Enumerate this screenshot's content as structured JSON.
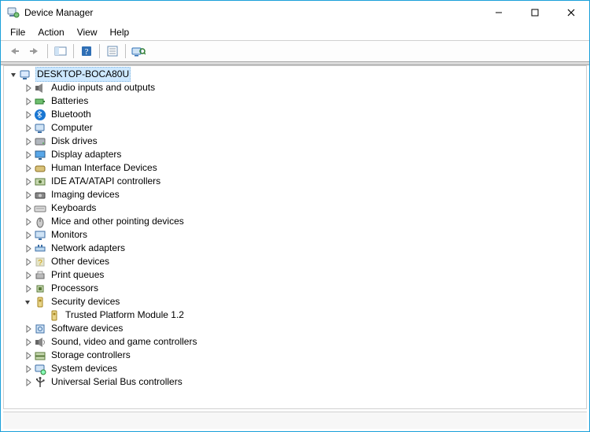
{
  "window": {
    "title": "Device Manager"
  },
  "menubar": {
    "items": [
      "File",
      "Action",
      "View",
      "Help"
    ]
  },
  "toolbar": {
    "back": "Back",
    "forward": "Forward",
    "show_hide_console_tree": "Show/Hide Console Tree",
    "help": "Help",
    "properties": "Properties",
    "scan": "Scan for hardware changes"
  },
  "tree": {
    "root": {
      "label": "DESKTOP-BOCA80U",
      "expanded": true,
      "selected": true,
      "icon": "computer-root-icon"
    },
    "categories": [
      {
        "label": "Audio inputs and outputs",
        "icon": "audio-icon",
        "expanded": false
      },
      {
        "label": "Batteries",
        "icon": "battery-icon",
        "expanded": false
      },
      {
        "label": "Bluetooth",
        "icon": "bluetooth-icon",
        "expanded": false
      },
      {
        "label": "Computer",
        "icon": "computer-icon",
        "expanded": false
      },
      {
        "label": "Disk drives",
        "icon": "disk-icon",
        "expanded": false
      },
      {
        "label": "Display adapters",
        "icon": "display-icon",
        "expanded": false
      },
      {
        "label": "Human Interface Devices",
        "icon": "hid-icon",
        "expanded": false
      },
      {
        "label": "IDE ATA/ATAPI controllers",
        "icon": "ide-icon",
        "expanded": false
      },
      {
        "label": "Imaging devices",
        "icon": "imaging-icon",
        "expanded": false
      },
      {
        "label": "Keyboards",
        "icon": "keyboard-icon",
        "expanded": false
      },
      {
        "label": "Mice and other pointing devices",
        "icon": "mouse-icon",
        "expanded": false
      },
      {
        "label": "Monitors",
        "icon": "monitor-icon",
        "expanded": false
      },
      {
        "label": "Network adapters",
        "icon": "network-icon",
        "expanded": false
      },
      {
        "label": "Other devices",
        "icon": "other-icon",
        "expanded": false
      },
      {
        "label": "Print queues",
        "icon": "printer-icon",
        "expanded": false
      },
      {
        "label": "Processors",
        "icon": "cpu-icon",
        "expanded": false
      },
      {
        "label": "Security devices",
        "icon": "security-icon",
        "expanded": true,
        "children": [
          {
            "label": "Trusted Platform Module 1.2",
            "icon": "security-icon"
          }
        ]
      },
      {
        "label": "Software devices",
        "icon": "software-icon",
        "expanded": false
      },
      {
        "label": "Sound, video and game controllers",
        "icon": "sound-icon",
        "expanded": false
      },
      {
        "label": "Storage controllers",
        "icon": "storage-icon",
        "expanded": false
      },
      {
        "label": "System devices",
        "icon": "system-icon",
        "expanded": false
      },
      {
        "label": "Universal Serial Bus controllers",
        "icon": "usb-icon",
        "expanded": false
      }
    ]
  }
}
